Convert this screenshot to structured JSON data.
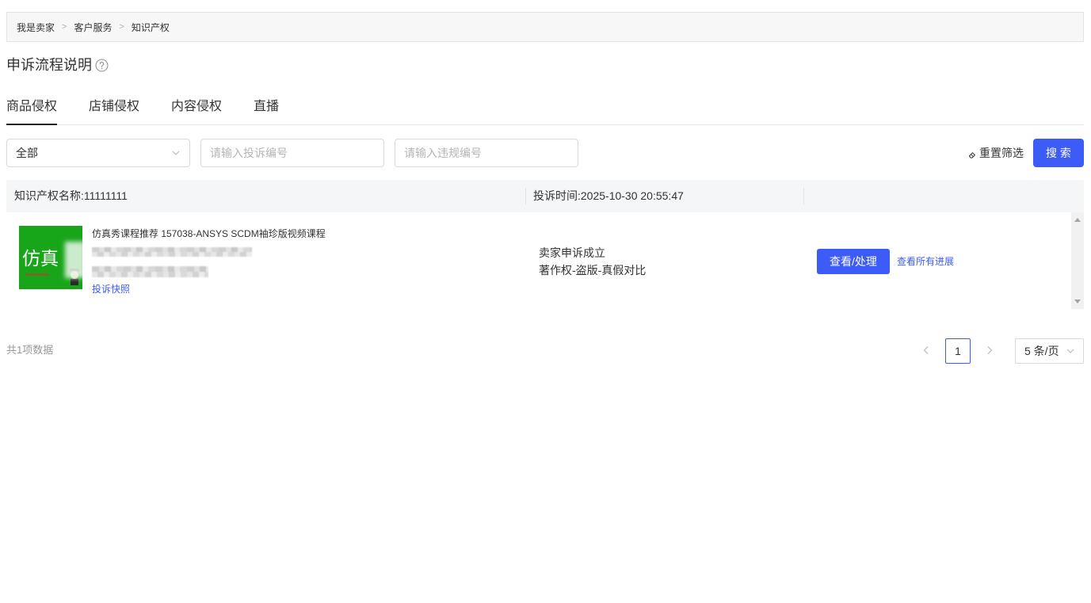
{
  "breadcrumb": {
    "items": [
      "我是卖家",
      "客户服务",
      "知识产权"
    ],
    "separator": ">"
  },
  "page": {
    "title": "申诉流程说明",
    "help_icon": "question-circle-icon"
  },
  "tabs": [
    {
      "label": "商品侵权",
      "active": true
    },
    {
      "label": "店铺侵权",
      "active": false
    },
    {
      "label": "内容侵权",
      "active": false
    },
    {
      "label": "直播",
      "active": false
    }
  ],
  "filters": {
    "status_select": {
      "value": "全部",
      "icon": "chevron-down-icon"
    },
    "complaint_no": {
      "placeholder": "请输入投诉编号",
      "value": ""
    },
    "violation_no": {
      "placeholder": "请输入违规编号",
      "value": ""
    },
    "reset": {
      "label": "重置筛选",
      "icon": "eraser-icon"
    },
    "search": {
      "label": "搜 索"
    }
  },
  "records": [
    {
      "ip_name_label": "知识产权名称:",
      "ip_name": "11111111",
      "complaint_time_label": "投诉时间:",
      "complaint_time": "2025-10-30 20:55:47",
      "thumbnail_text": "仿真",
      "product_title": "仿真秀课程推荐 157038-ANSYS SCDM袖珍版视频课程",
      "snapshot_link": "投诉快照",
      "status": "卖家申诉成立",
      "reason": "著作权-盗版-真假对比",
      "action_button": "查看/处理",
      "progress_link": "查看所有进展"
    }
  ],
  "pagination": {
    "total_text": "共1项数据",
    "current_page": "1",
    "page_size": "5 条/页",
    "prev_icon": "chevron-left-icon",
    "next_icon": "chevron-right-icon",
    "page_size_icon": "chevron-down-icon"
  },
  "colors": {
    "accent": "#3d5bf6",
    "thumbnail_bg": "#19a51a"
  }
}
